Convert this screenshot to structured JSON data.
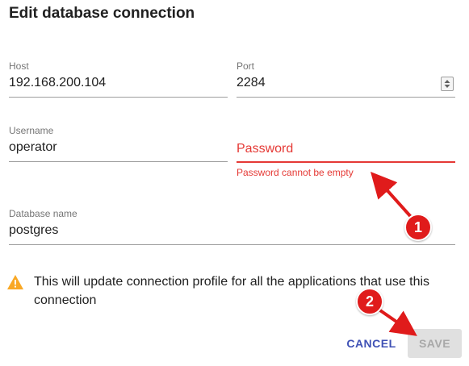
{
  "dialog": {
    "title": "Edit database connection"
  },
  "fields": {
    "host": {
      "label": "Host",
      "value": "192.168.200.104"
    },
    "port": {
      "label": "Port",
      "value": "2284"
    },
    "username": {
      "label": "Username",
      "value": "operator"
    },
    "password": {
      "placeholder": "Password",
      "value": "",
      "error": "Password cannot be empty"
    },
    "database_name": {
      "label": "Database name",
      "value": "postgres"
    }
  },
  "warning": {
    "icon": "warning-icon",
    "text": "This will update connection profile for all the applications that use this connection"
  },
  "actions": {
    "cancel_label": "CANCEL",
    "save_label": "SAVE"
  },
  "annotations": {
    "badge_1": "1",
    "badge_2": "2"
  },
  "colors": {
    "error": "#e53935",
    "primary": "#3f51b5",
    "warning": "#f9a825",
    "annotation": "#e01b1b",
    "disabled_bg": "#e0e0e0",
    "disabled_text": "#a8a8a8"
  }
}
